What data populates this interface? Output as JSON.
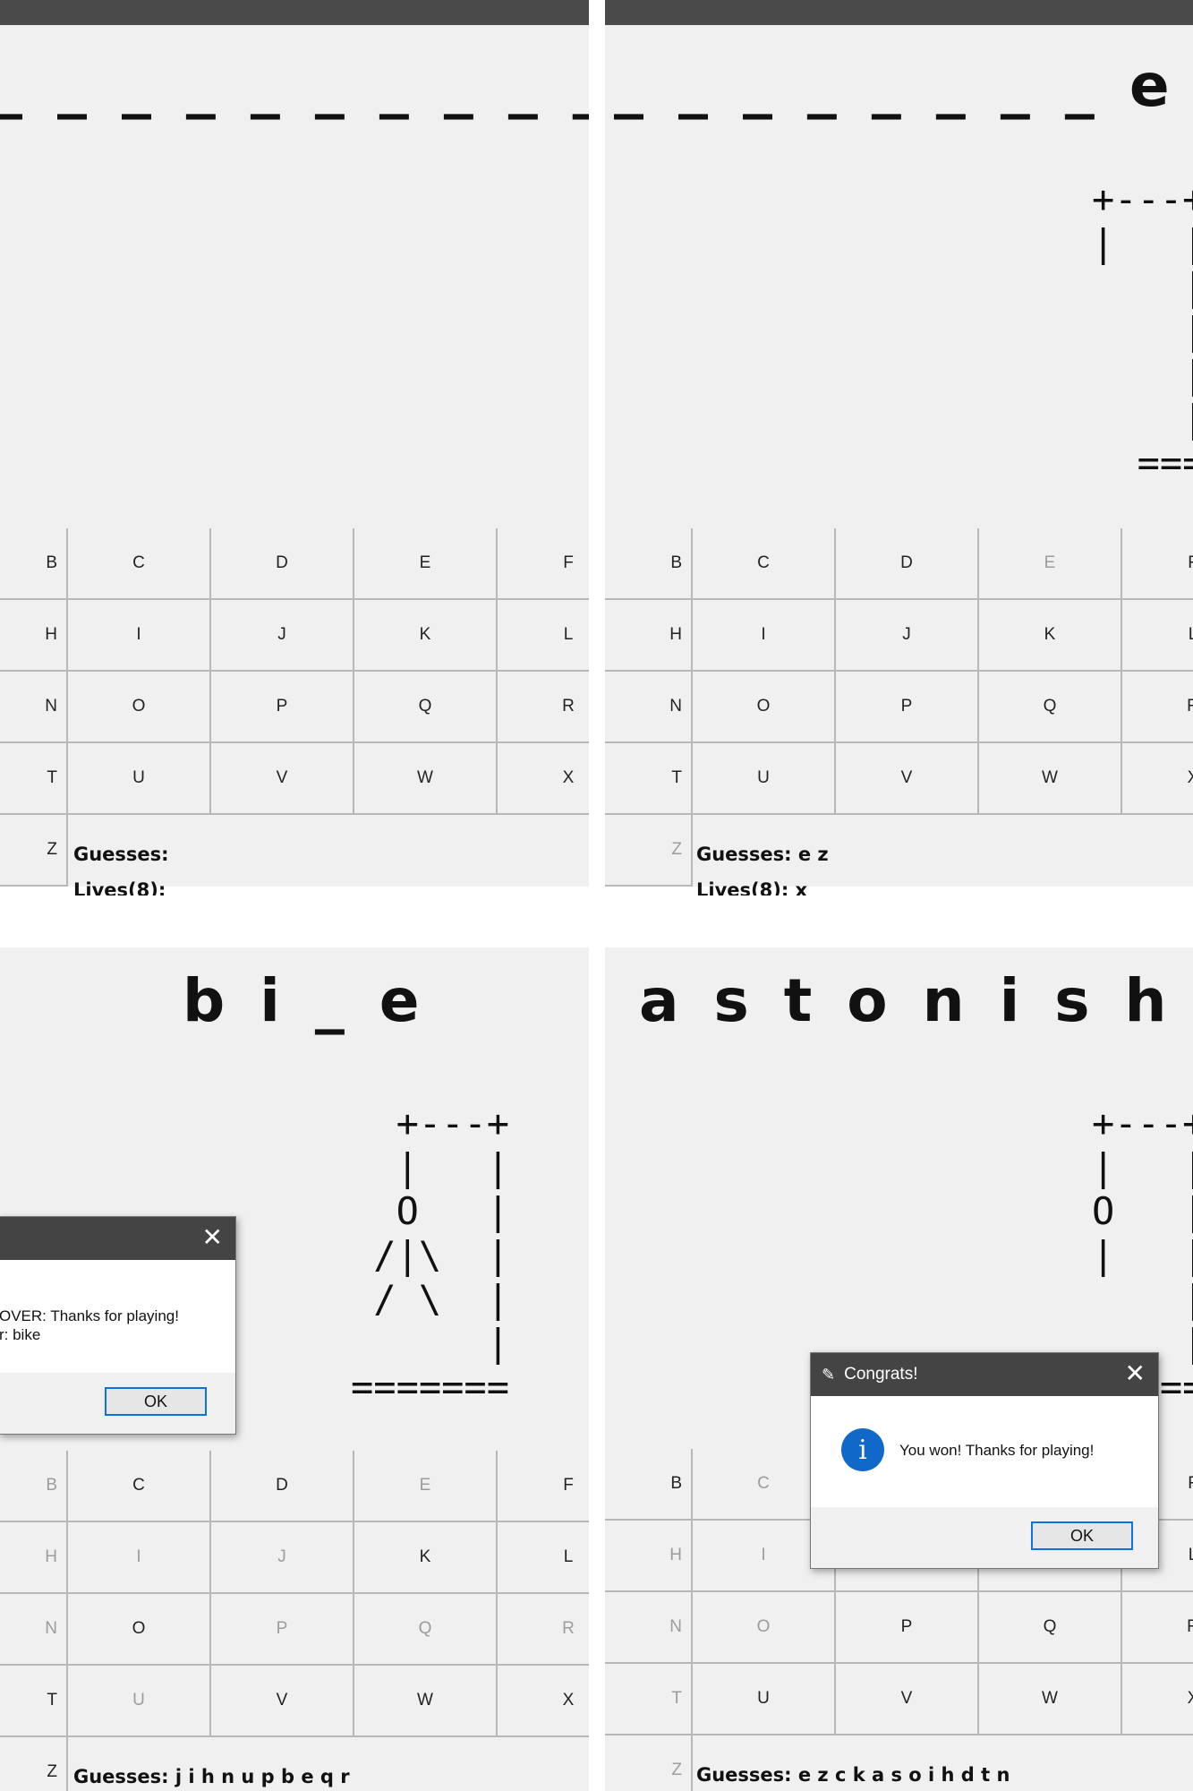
{
  "panels": {
    "tl": {
      "word": "_ _ _ _ _ _ _ _ _ _",
      "gallows": "",
      "keys": [
        {
          "label": "B",
          "used": false
        },
        {
          "label": "C",
          "used": false
        },
        {
          "label": "D",
          "used": false
        },
        {
          "label": "E",
          "used": false
        },
        {
          "label": "F",
          "used": false
        },
        {
          "label": "H",
          "used": false
        },
        {
          "label": "I",
          "used": false
        },
        {
          "label": "J",
          "used": false
        },
        {
          "label": "K",
          "used": false
        },
        {
          "label": "L",
          "used": false
        },
        {
          "label": "N",
          "used": false
        },
        {
          "label": "O",
          "used": false
        },
        {
          "label": "P",
          "used": false
        },
        {
          "label": "Q",
          "used": false
        },
        {
          "label": "R",
          "used": false
        },
        {
          "label": "T",
          "used": false
        },
        {
          "label": "U",
          "used": false
        },
        {
          "label": "V",
          "used": false
        },
        {
          "label": "W",
          "used": false
        },
        {
          "label": "X",
          "used": false
        },
        {
          "label": "Z",
          "used": false
        }
      ],
      "guesses": "Guesses:",
      "lives": "Lives(8):"
    },
    "tr": {
      "word": "_ _ _ _ _ _ _ _ e _",
      "gallows": "+---+\n|   |\n    |\n    |\n    |\n    |\n  =======",
      "keys": [
        {
          "label": "B",
          "used": false
        },
        {
          "label": "C",
          "used": false
        },
        {
          "label": "D",
          "used": false
        },
        {
          "label": "E",
          "used": true
        },
        {
          "label": "F",
          "used": false
        },
        {
          "label": "H",
          "used": false
        },
        {
          "label": "I",
          "used": false
        },
        {
          "label": "J",
          "used": false
        },
        {
          "label": "K",
          "used": false
        },
        {
          "label": "L",
          "used": false
        },
        {
          "label": "N",
          "used": false
        },
        {
          "label": "O",
          "used": false
        },
        {
          "label": "P",
          "used": false
        },
        {
          "label": "Q",
          "used": false
        },
        {
          "label": "R",
          "used": false
        },
        {
          "label": "T",
          "used": false
        },
        {
          "label": "U",
          "used": false
        },
        {
          "label": "V",
          "used": false
        },
        {
          "label": "W",
          "used": false
        },
        {
          "label": "X",
          "used": false
        },
        {
          "label": "Z",
          "used": true
        }
      ],
      "guesses": "Guesses: e z",
      "lives": "Lives(8): x"
    },
    "bl": {
      "word": "b i _ e",
      "gallows": "  +---+\n  |   |\n  O   |\n /|\\  |\n / \\  |\n      |\n=======",
      "keys": [
        {
          "label": "B",
          "used": true
        },
        {
          "label": "C",
          "used": false
        },
        {
          "label": "D",
          "used": false
        },
        {
          "label": "E",
          "used": true
        },
        {
          "label": "F",
          "used": false
        },
        {
          "label": "H",
          "used": true
        },
        {
          "label": "I",
          "used": true
        },
        {
          "label": "J",
          "used": true
        },
        {
          "label": "K",
          "used": false
        },
        {
          "label": "L",
          "used": false
        },
        {
          "label": "N",
          "used": true
        },
        {
          "label": "O",
          "used": false
        },
        {
          "label": "P",
          "used": true
        },
        {
          "label": "Q",
          "used": true
        },
        {
          "label": "R",
          "used": true
        },
        {
          "label": "T",
          "used": false
        },
        {
          "label": "U",
          "used": true
        },
        {
          "label": "V",
          "used": false
        },
        {
          "label": "W",
          "used": false
        },
        {
          "label": "X",
          "used": false
        },
        {
          "label": "Z",
          "used": false
        }
      ],
      "guesses": "Guesses: j i h n u p b e q r",
      "lives": "",
      "dialog": {
        "message": "OVER: Thanks for playing!\nr: bike",
        "ok": "OK"
      }
    },
    "br": {
      "word": "a s t o n i s h e d",
      "gallows": "+---+\n|   |\nO   |\n|   |\n    |\n    |\n  =======",
      "keys": [
        {
          "label": "B",
          "used": false
        },
        {
          "label": "C",
          "used": true
        },
        {
          "label": "D",
          "used": true
        },
        {
          "label": "E",
          "used": true
        },
        {
          "label": "F",
          "used": false
        },
        {
          "label": "H",
          "used": true
        },
        {
          "label": "I",
          "used": true
        },
        {
          "label": "J",
          "used": false
        },
        {
          "label": "K",
          "used": true
        },
        {
          "label": "L",
          "used": false
        },
        {
          "label": "N",
          "used": true
        },
        {
          "label": "O",
          "used": true
        },
        {
          "label": "P",
          "used": false
        },
        {
          "label": "Q",
          "used": false
        },
        {
          "label": "R",
          "used": false
        },
        {
          "label": "T",
          "used": true
        },
        {
          "label": "U",
          "used": false
        },
        {
          "label": "V",
          "used": false
        },
        {
          "label": "W",
          "used": false
        },
        {
          "label": "X",
          "used": false
        },
        {
          "label": "Z",
          "used": true
        }
      ],
      "guesses": "Guesses: e z c k a s o i h d t n",
      "lives": "",
      "dialog": {
        "title": "Congrats!",
        "message": "You won! Thanks for playing!",
        "ok": "OK"
      }
    }
  },
  "icons": {
    "close": "close-icon",
    "info": "info-icon",
    "feather": "feather-icon"
  },
  "colors": {
    "window_bg": "#f0f0f0",
    "titlebar": "#4a4a4a",
    "dialog_title": "#444444",
    "ok_border": "#0a74d9",
    "info_icon": "#1068c8",
    "used_key_text": "#9c9c9c"
  }
}
